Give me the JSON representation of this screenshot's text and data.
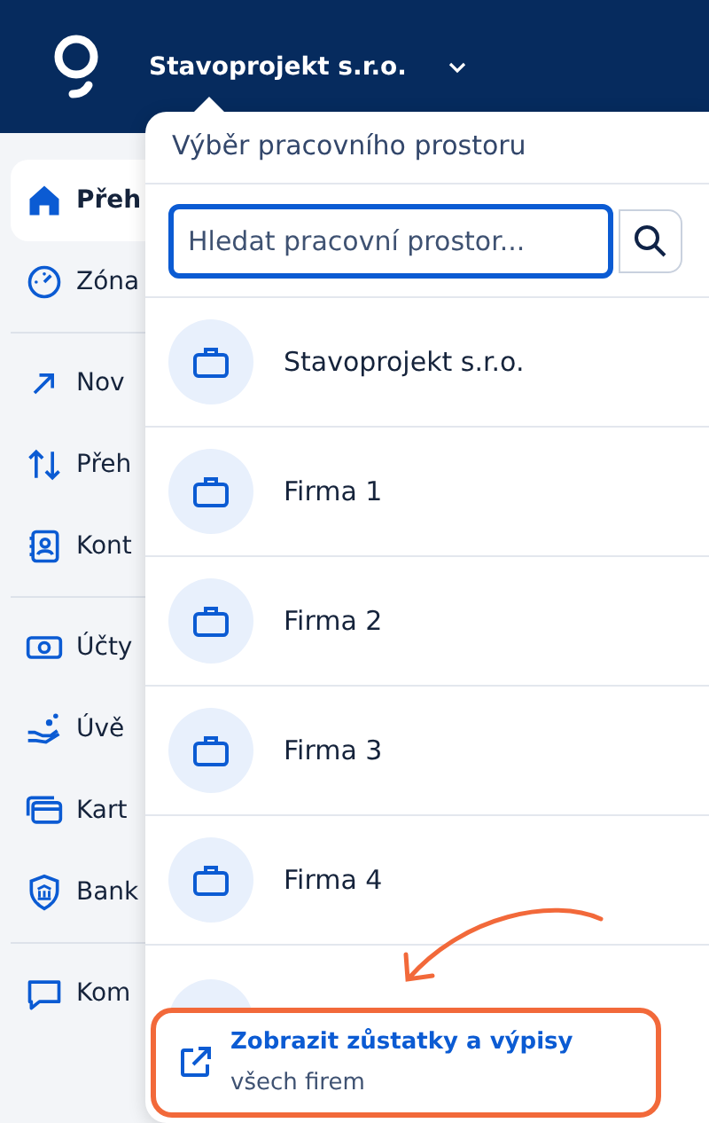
{
  "header": {
    "company": "Stavoprojekt s.r.o."
  },
  "sidebar": {
    "groups": [
      [
        {
          "label": "Přeh",
          "selected": true
        },
        {
          "label": "Zóna",
          "selected": false
        }
      ],
      [
        {
          "label": "Nov",
          "selected": false
        },
        {
          "label": "Přeh",
          "selected": false
        },
        {
          "label": "Kont",
          "selected": false
        }
      ],
      [
        {
          "label": "Účty",
          "selected": false
        },
        {
          "label": "Úvě",
          "selected": false
        },
        {
          "label": "Kart",
          "selected": false
        },
        {
          "label": "Bank",
          "selected": false
        }
      ],
      [
        {
          "label": "Kom",
          "selected": false
        }
      ]
    ]
  },
  "workspace_menu": {
    "title": "Výběr pracovního prostoru",
    "search": {
      "placeholder": "Hledat pracovní prostor..."
    },
    "workspaces": [
      {
        "name": "Stavoprojekt s.r.o."
      },
      {
        "name": "Firma 1"
      },
      {
        "name": "Firma 2"
      },
      {
        "name": "Firma 3"
      },
      {
        "name": "Firma 4"
      }
    ],
    "footer": {
      "title": "Zobrazit zůstatky a výpisy",
      "subtitle": "všech firem"
    }
  }
}
